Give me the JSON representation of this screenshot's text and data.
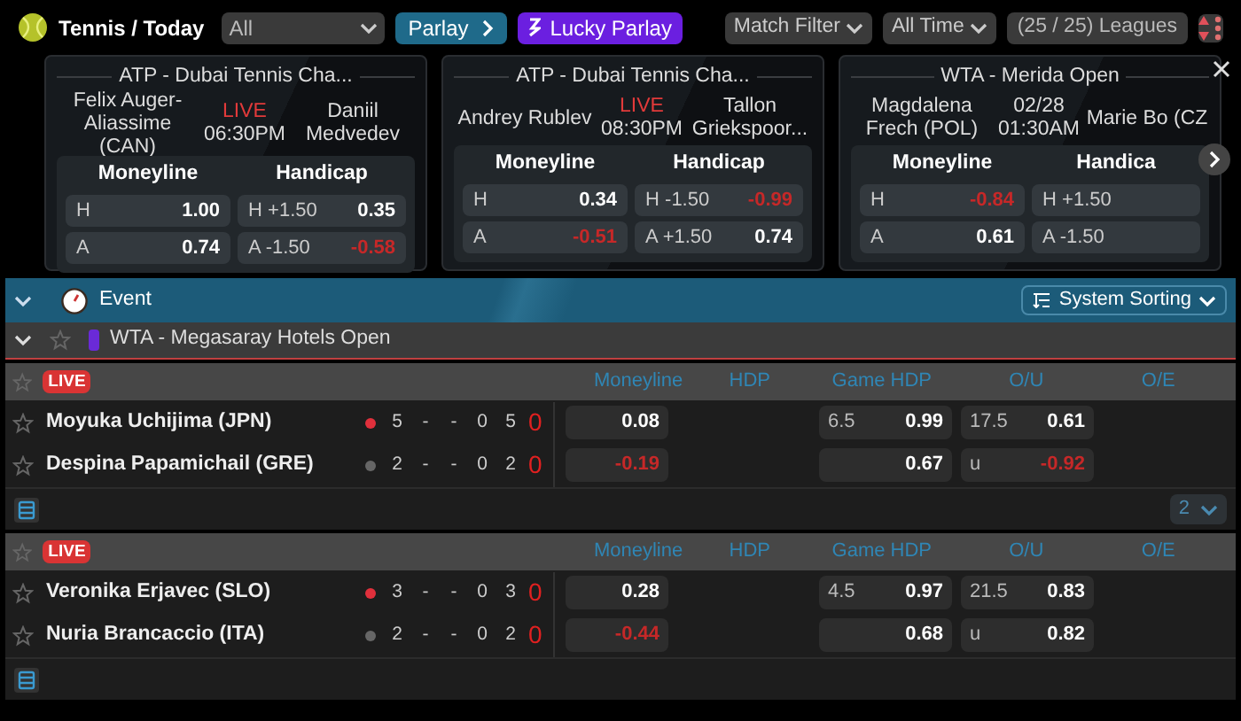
{
  "header": {
    "title": "Tennis / Today",
    "sport_select": "All",
    "parlay": "Parlay",
    "lucky_parlay": "Lucky Parlay",
    "filters": [
      "Match Filter",
      "All Time"
    ],
    "leagues": "(25 / 25) Leagues"
  },
  "featured": [
    {
      "league": "ATP - Dubai Tennis Cha...",
      "home": "Felix Auger-Aliassime (CAN)",
      "away": "Daniil Medvedev",
      "live": true,
      "status": "LIVE",
      "time": "06:30PM",
      "moneyline_label": "Moneyline",
      "handicap_label": "Handicap",
      "moneyline": [
        {
          "side": "H",
          "odds": "1.00",
          "down": false
        },
        {
          "side": "A",
          "odds": "0.74",
          "down": false
        }
      ],
      "handicap": [
        {
          "side": "H",
          "line": "+1.50",
          "odds": "0.35",
          "down": false
        },
        {
          "side": "A",
          "line": "-1.50",
          "odds": "-0.58",
          "down": true
        }
      ]
    },
    {
      "league": "ATP - Dubai Tennis Cha...",
      "home": "Andrey Rublev",
      "away": "Tallon Griekspoor...",
      "live": true,
      "status": "LIVE",
      "time": "08:30PM",
      "moneyline_label": "Moneyline",
      "handicap_label": "Handicap",
      "moneyline": [
        {
          "side": "H",
          "odds": "0.34",
          "down": false
        },
        {
          "side": "A",
          "odds": "-0.51",
          "down": true
        }
      ],
      "handicap": [
        {
          "side": "H",
          "line": "-1.50",
          "odds": "-0.99",
          "down": true
        },
        {
          "side": "A",
          "line": "+1.50",
          "odds": "0.74",
          "down": false
        }
      ]
    },
    {
      "league": "WTA - Merida Open",
      "home": "Magdalena Frech (POL)",
      "away": "Marie Bo (CZ",
      "live": false,
      "status": "02/28",
      "time": "01:30AM",
      "moneyline_label": "Moneyline",
      "handicap_label": "Handica",
      "moneyline": [
        {
          "side": "H",
          "odds": "-0.84",
          "down": true
        },
        {
          "side": "A",
          "odds": "0.61",
          "down": false
        }
      ],
      "handicap": [
        {
          "side": "H",
          "line": "+1.50"
        },
        {
          "side": "A",
          "line": "-1.50"
        }
      ]
    }
  ],
  "event_bar": {
    "label": "Event",
    "sorting": "System Sorting"
  },
  "league": {
    "name": "WTA - Megasaray Hotels Open",
    "expanded": true
  },
  "matches": [
    {
      "badge": "LIVE",
      "columns": [
        "Moneyline",
        "HDP",
        "Game HDP",
        "O/U",
        "O/E"
      ],
      "page_select": "2",
      "players": [
        {
          "name": "Moyuka Uchijima (JPN)",
          "serving": true,
          "scores": [
            "5",
            "-",
            "-",
            "0",
            "5"
          ],
          "points": "0",
          "moneyline": {
            "odds": "0.08",
            "down": false
          },
          "game_hdp": {
            "line": "6.5",
            "odds": "0.99",
            "down": false
          },
          "ou": {
            "line": "17.5",
            "odds": "0.61",
            "down": false
          }
        },
        {
          "name": "Despina Papamichail (GRE)",
          "serving": false,
          "scores": [
            "2",
            "-",
            "-",
            "0",
            "2"
          ],
          "points": "0",
          "moneyline": {
            "odds": "-0.19",
            "down": true
          },
          "game_hdp": {
            "odds": "0.67",
            "down": false
          },
          "ou": {
            "line": "u",
            "odds": "-0.92",
            "down": true
          }
        }
      ]
    },
    {
      "badge": "LIVE",
      "columns": [
        "Moneyline",
        "HDP",
        "Game HDP",
        "O/U",
        "O/E"
      ],
      "players": [
        {
          "name": "Veronika Erjavec (SLO)",
          "serving": true,
          "scores": [
            "3",
            "-",
            "-",
            "0",
            "3"
          ],
          "points": "0",
          "moneyline": {
            "odds": "0.28",
            "down": false
          },
          "game_hdp": {
            "line": "4.5",
            "odds": "0.97",
            "down": false
          },
          "ou": {
            "line": "21.5",
            "odds": "0.83",
            "down": false
          }
        },
        {
          "name": "Nuria Brancaccio (ITA)",
          "serving": false,
          "scores": [
            "2",
            "-",
            "-",
            "0",
            "2"
          ],
          "points": "0",
          "moneyline": {
            "odds": "-0.44",
            "down": true
          },
          "game_hdp": {
            "odds": "0.68",
            "down": false
          },
          "ou": {
            "line": "u",
            "odds": "0.82",
            "down": false
          }
        }
      ]
    }
  ]
}
